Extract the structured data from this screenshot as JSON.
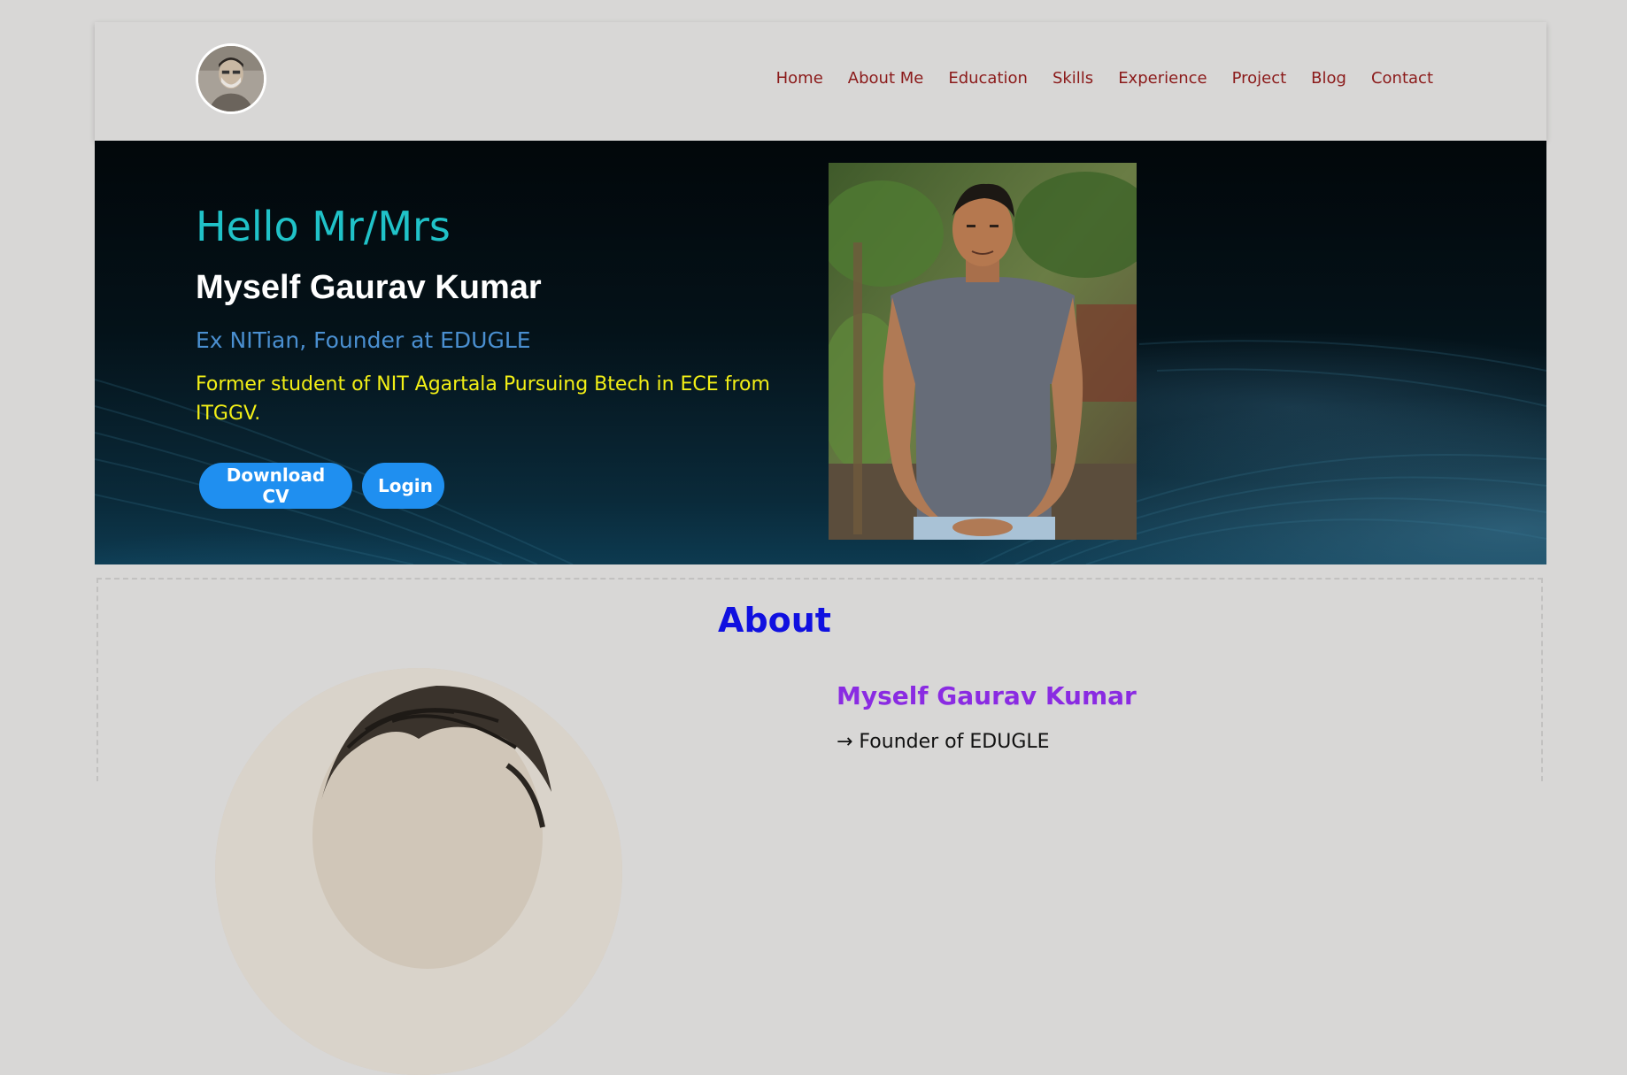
{
  "nav": {
    "items": [
      "Home",
      "About Me",
      "Education",
      "Skills",
      "Experience",
      "Project",
      "Blog",
      "Contact"
    ]
  },
  "hero": {
    "greeting": "Hello Mr/Mrs",
    "name": "Myself Gaurav Kumar",
    "role": "Ex NITian, Founder at EDUGLE",
    "description": "Former student of NIT Agartala Pursuing Btech in ECE from ITGGV.",
    "download_label": "Download CV",
    "login_label": "Login"
  },
  "about": {
    "title": "About",
    "name": "Myself Gaurav Kumar",
    "lines": [
      "→ Founder of EDUGLE"
    ]
  },
  "colors": {
    "nav_link": "#8b1a1a",
    "greeting": "#20c2c8",
    "role": "#4a8fd0",
    "description": "#f2ef16",
    "button": "#1f8ff0",
    "about_title": "#1010e0",
    "about_name": "#8a2be2"
  }
}
